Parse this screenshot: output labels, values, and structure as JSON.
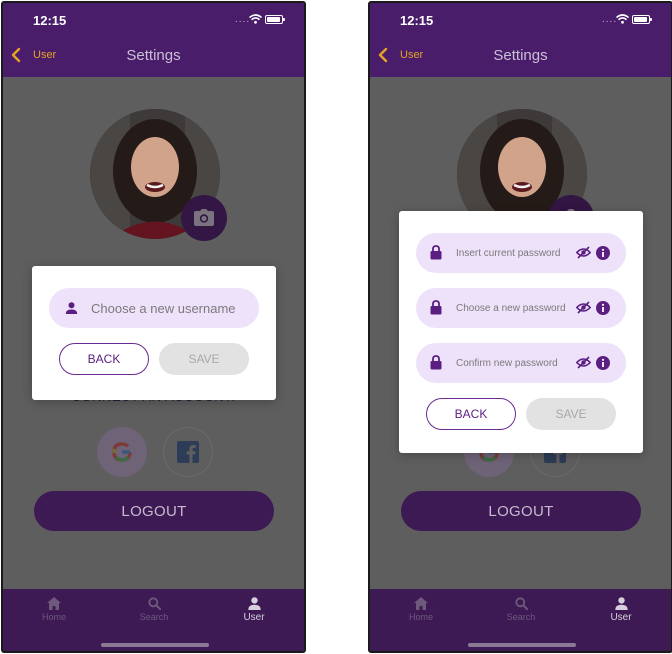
{
  "status": {
    "time": "12:15",
    "signal_dots": "...."
  },
  "header": {
    "back_label": "User",
    "title": "Settings"
  },
  "connect": {
    "label": "CONNECT AN ACCOUNT:"
  },
  "logout": {
    "label": "LOGOUT"
  },
  "tabs": [
    {
      "label": "Home",
      "icon": "home-icon"
    },
    {
      "label": "Search",
      "icon": "search-icon"
    },
    {
      "label": "User",
      "icon": "user-icon",
      "active": true
    }
  ],
  "username_dialog": {
    "field_placeholder": "Choose a new username",
    "back_label": "BACK",
    "save_label": "SAVE"
  },
  "password_dialog": {
    "fields": [
      {
        "placeholder": "Insert current password"
      },
      {
        "placeholder": "Choose a new password"
      },
      {
        "placeholder": "Confirm new password"
      }
    ],
    "back_label": "BACK",
    "save_label": "SAVE"
  },
  "colors": {
    "brand_purple": "#4a1d6b",
    "field_background": "#eee2fb",
    "back_accent": "#e3a326"
  }
}
